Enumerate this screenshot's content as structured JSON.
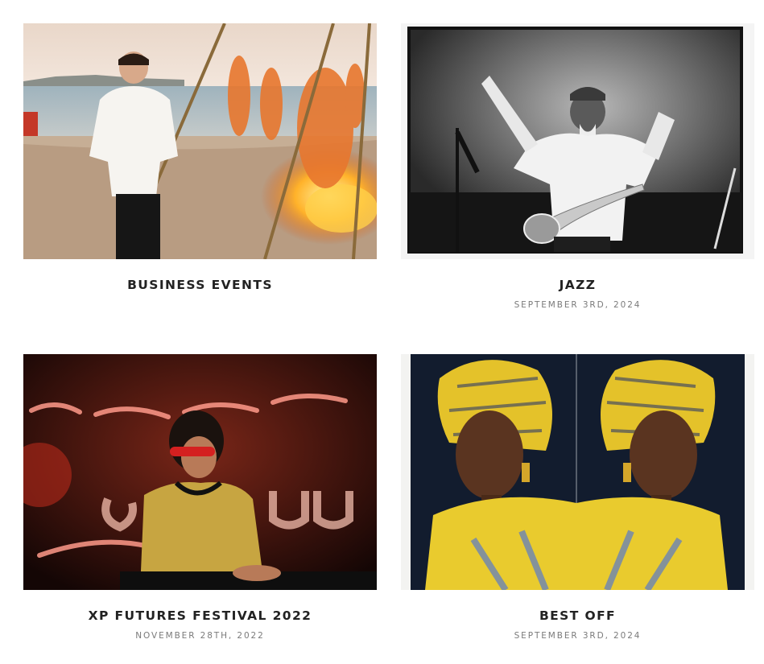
{
  "posts": [
    {
      "title": "BUSINESS EVENTS",
      "date": "",
      "image_icon": "chef-beach-photo"
    },
    {
      "title": "JAZZ",
      "date": "SEPTEMBER 3RD, 2024",
      "image_icon": "saxophonist-bw-photo"
    },
    {
      "title": "XP FUTURES FESTIVAL 2022",
      "date": "NOVEMBER 28TH, 2022",
      "image_icon": "dj-festival-photo"
    },
    {
      "title": "BEST OFF",
      "date": "SEPTEMBER 3RD, 2024",
      "image_icon": "mirrored-portrait-photo"
    }
  ],
  "colors": {
    "title": "#222222",
    "date": "#7a7a7a",
    "background": "#ffffff"
  }
}
